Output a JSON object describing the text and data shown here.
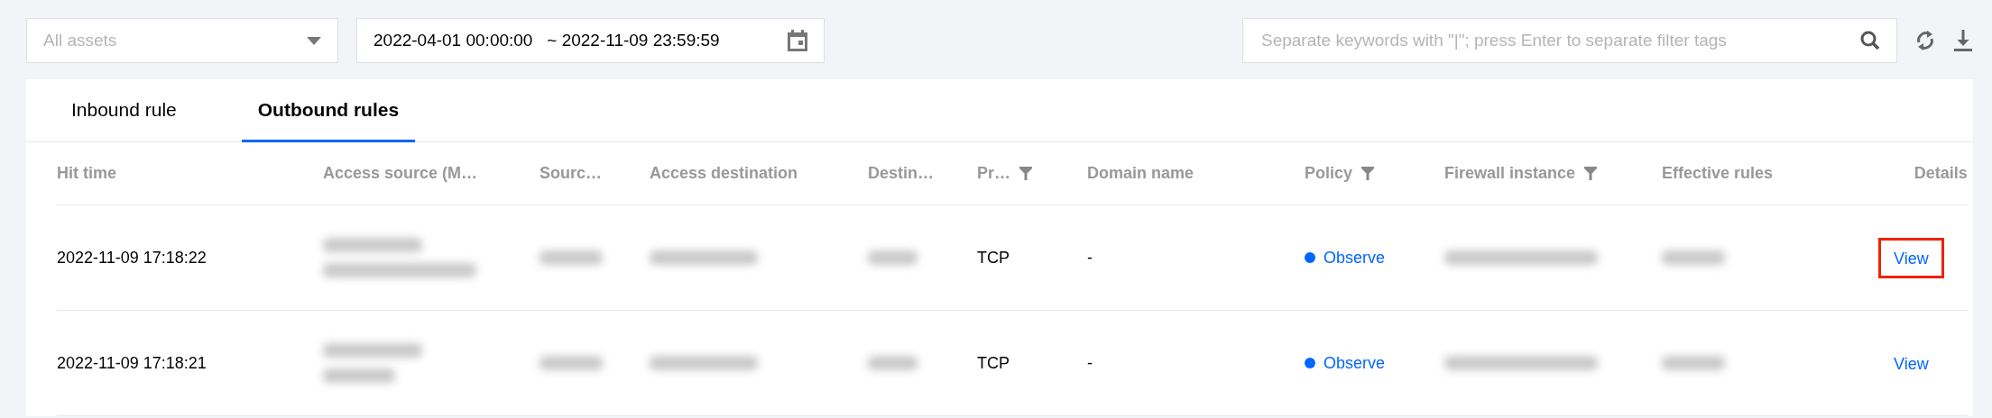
{
  "toolbar": {
    "asset_select": {
      "placeholder": "All assets"
    },
    "date_range": {
      "value": "2022-04-01 00:00:00   ~ 2022-11-09 23:59:59"
    },
    "search": {
      "placeholder": "Separate keywords with \"|\"; press Enter to separate filter tags"
    }
  },
  "tabs": [
    {
      "label": "Inbound rule",
      "selected": false
    },
    {
      "label": "Outbound rules",
      "selected": true
    }
  ],
  "table": {
    "columns": [
      {
        "label": "Hit time",
        "filter": false
      },
      {
        "label": "Access source (M…",
        "filter": false
      },
      {
        "label": "Sourc…",
        "filter": false
      },
      {
        "label": "Access destination",
        "filter": false
      },
      {
        "label": "Destin…",
        "filter": false
      },
      {
        "label": "Pr…",
        "filter": true
      },
      {
        "label": "Domain name",
        "filter": false
      },
      {
        "label": "Policy",
        "filter": true
      },
      {
        "label": "Firewall instance",
        "filter": true
      },
      {
        "label": "Effective rules",
        "filter": false
      },
      {
        "label": "Details",
        "filter": false
      }
    ],
    "rows": [
      {
        "cells": [
          {
            "kind": "text",
            "text": "2022-11-09 17:18:22"
          },
          {
            "kind": "blurred"
          },
          {
            "kind": "blurred"
          },
          {
            "kind": "blurred"
          },
          {
            "kind": "blurred"
          },
          {
            "kind": "text",
            "text": "TCP"
          },
          {
            "kind": "text",
            "text": "-"
          },
          {
            "kind": "status",
            "text": "Observe",
            "color": "#0066ff"
          },
          {
            "kind": "blurred"
          },
          {
            "kind": "blurred"
          },
          {
            "kind": "link",
            "text": "View",
            "highlighted": true
          }
        ]
      },
      {
        "cells": [
          {
            "kind": "text",
            "text": "2022-11-09 17:18:21"
          },
          {
            "kind": "blurred"
          },
          {
            "kind": "blurred"
          },
          {
            "kind": "blurred"
          },
          {
            "kind": "blurred"
          },
          {
            "kind": "text",
            "text": "TCP"
          },
          {
            "kind": "text",
            "text": "-"
          },
          {
            "kind": "status",
            "text": "Observe",
            "color": "#0066ff"
          },
          {
            "kind": "blurred"
          },
          {
            "kind": "blurred"
          },
          {
            "kind": "link",
            "text": "View",
            "highlighted": false
          }
        ]
      }
    ]
  }
}
